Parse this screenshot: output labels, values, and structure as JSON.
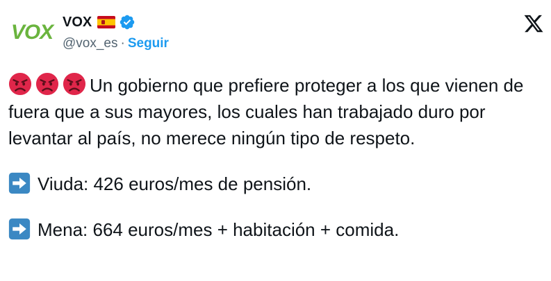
{
  "tweet": {
    "avatar": {
      "logo_text": "VOX",
      "logo_color": "#6ab43e"
    },
    "author": {
      "display_name": "VOX",
      "flag_icon": "spain-flag-icon",
      "verified_icon": "verified-badge-icon",
      "handle": "@vox_es",
      "separator": "·",
      "follow_label": "Seguir"
    },
    "platform_icon": "x-logo-icon",
    "paragraphs": [
      {
        "emoji": [
          "angry-face-icon",
          "angry-face-icon",
          "angry-face-icon"
        ],
        "text": "Un gobierno que prefiere proteger a los que vienen de fuera que a sus mayores, los cuales han trabajado duro por levantar al país, no merece ningún tipo de respeto."
      },
      {
        "emoji": [
          "right-arrow-icon"
        ],
        "text": "Viuda: 426 euros/mes de pensión."
      },
      {
        "emoji": [
          "right-arrow-icon"
        ],
        "text": "Mena: 664 euros/mes + habitación + comida."
      }
    ]
  },
  "colors": {
    "text": "#0f1419",
    "secondary": "#536471",
    "link": "#1d9bf0",
    "verified": "#1d9bf0",
    "emoji_angry": "#e0264a",
    "emoji_arrow": "#3b88c3"
  }
}
